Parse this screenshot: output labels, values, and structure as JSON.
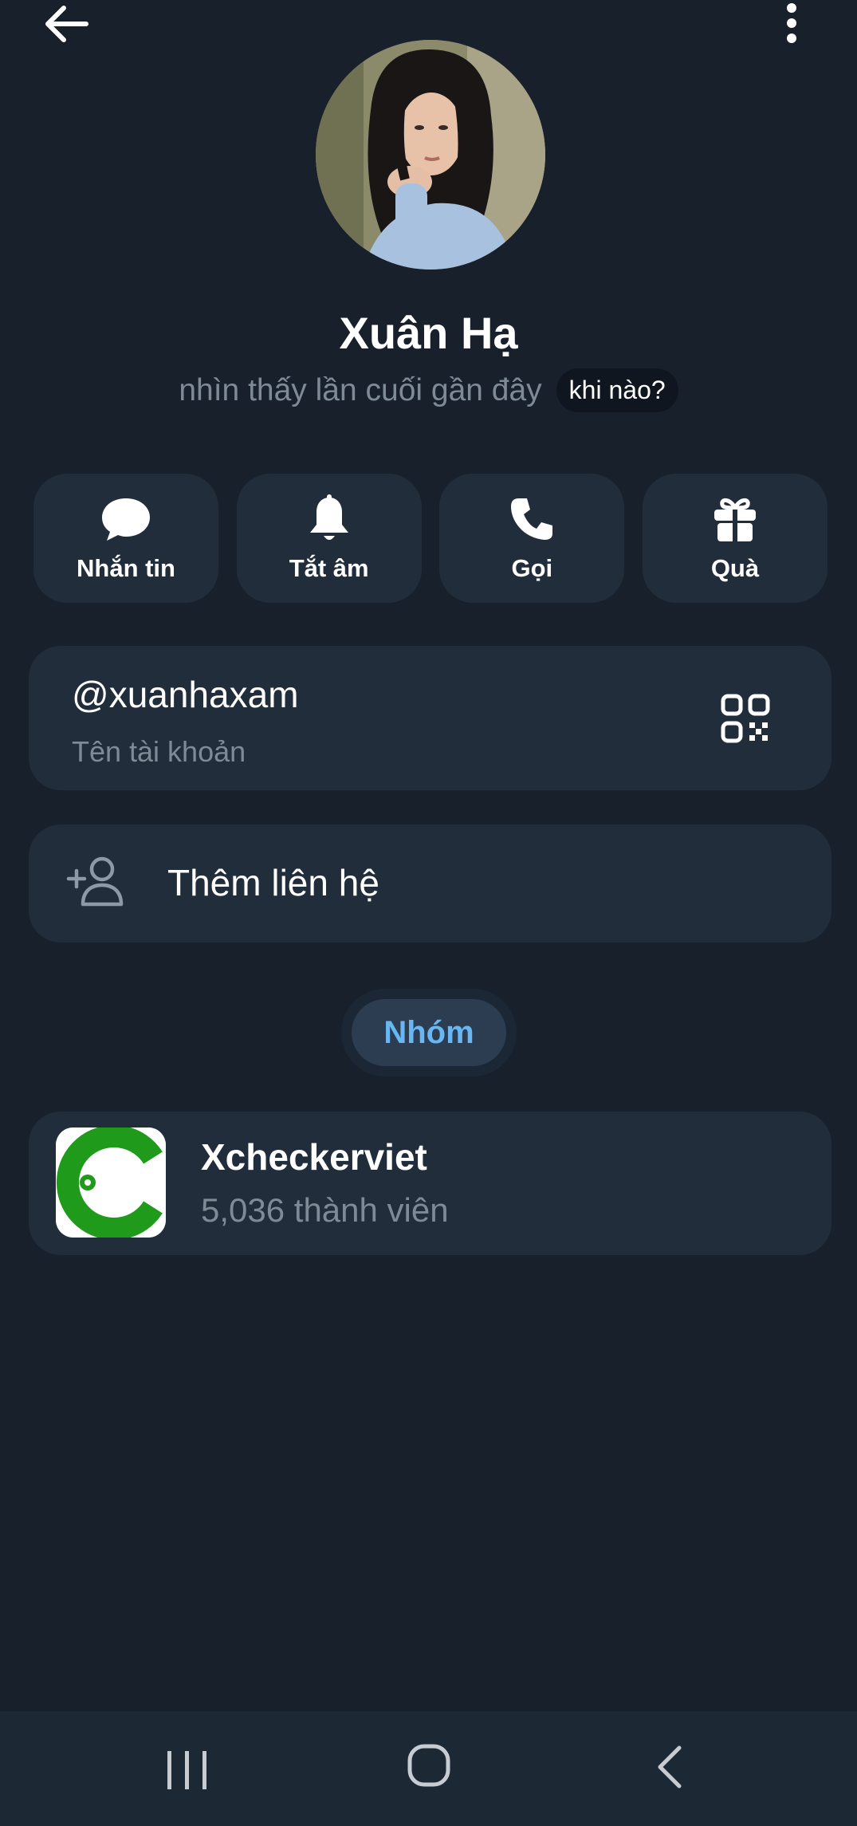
{
  "profile": {
    "name": "Xuân Hạ",
    "last_seen": "nhìn thấy lần cuối gần đây",
    "when_badge": "khi nào?"
  },
  "actions": [
    {
      "label": "Nhắn tin",
      "icon": "chat-bubble-icon"
    },
    {
      "label": "Tắt âm",
      "icon": "bell-icon"
    },
    {
      "label": "Gọi",
      "icon": "phone-icon"
    },
    {
      "label": "Quà",
      "icon": "gift-icon"
    }
  ],
  "username": {
    "value": "@xuanhaxam",
    "caption": "Tên tài khoản",
    "icon": "qr-code-icon"
  },
  "add_contact": {
    "label": "Thêm liên hệ",
    "icon": "add-person-icon"
  },
  "tabs": {
    "groups": "Nhóm"
  },
  "group": {
    "name": "Xcheckerviet",
    "members": "5,036 thành viên",
    "logo_color": "#1f9a1b"
  },
  "colors": {
    "background": "#17202b",
    "card": "#212d3b",
    "accent": "#69b7f2",
    "secondary_text": "#7f8a97"
  }
}
